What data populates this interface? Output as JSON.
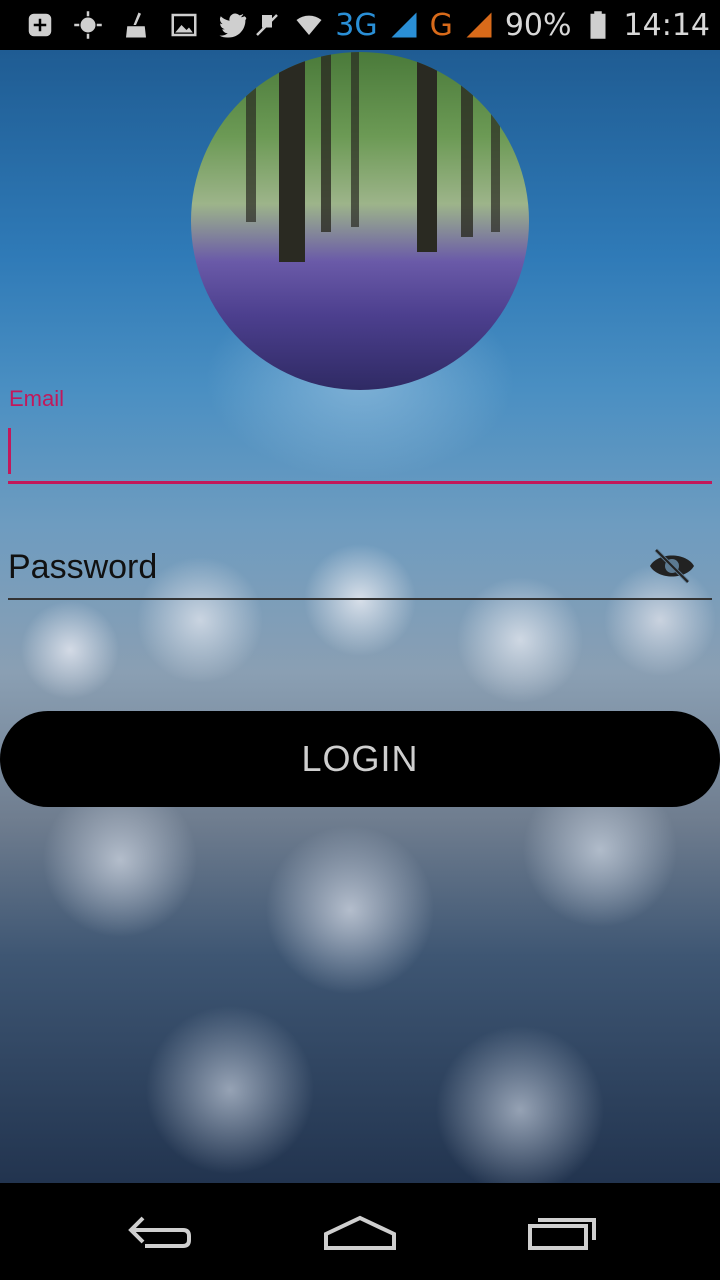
{
  "status_bar": {
    "icons_left": [
      "add-icon",
      "brightness-icon",
      "cleaner-icon",
      "image-icon",
      "twitter-icon"
    ],
    "icons_right": [
      "mute-icon",
      "wifi-icon",
      "signal-icon",
      "signal-roaming-icon",
      "battery-icon"
    ],
    "network_3g": "3G",
    "network_g": "G",
    "battery": "90%",
    "time": "14:14"
  },
  "login": {
    "email_label": "Email",
    "email_value": "",
    "password_placeholder": "Password",
    "login_button": "LOGIN"
  },
  "colors": {
    "accent": "#c2185b",
    "button_bg": "#000000"
  },
  "nav_bar": {
    "buttons": [
      "back-icon",
      "home-icon",
      "recents-icon"
    ]
  }
}
